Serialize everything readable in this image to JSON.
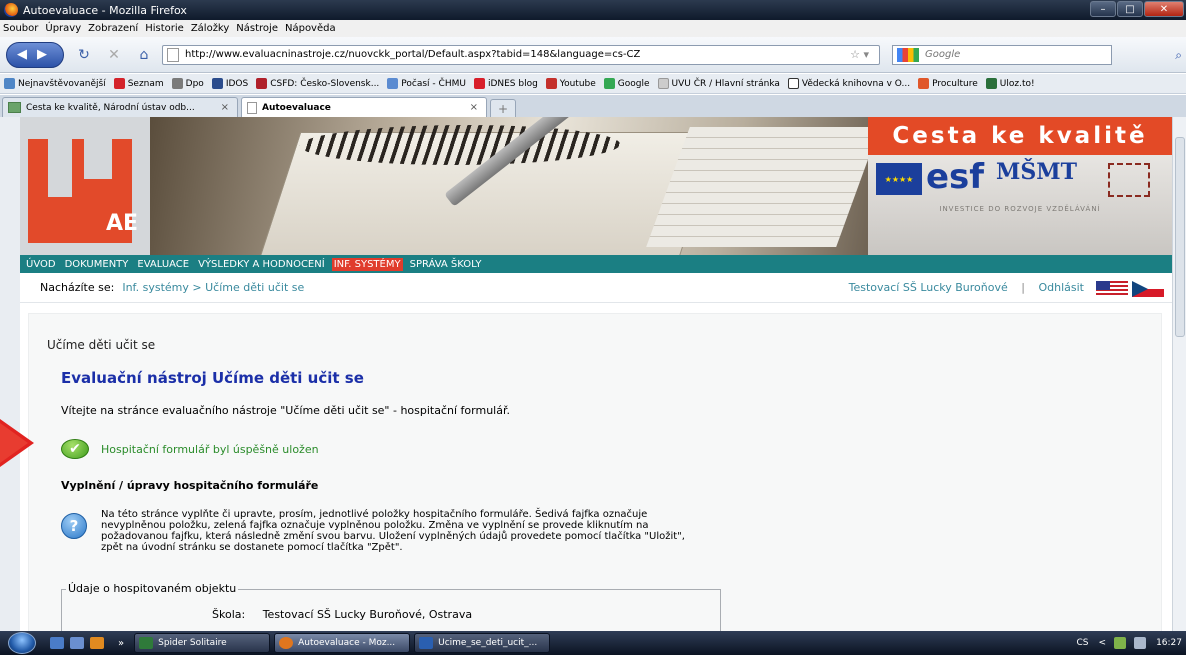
{
  "window": {
    "title": "Autoevaluace - Mozilla Firefox",
    "min": "–",
    "max": "□",
    "close": "✕"
  },
  "menu": [
    "Soubor",
    "Úpravy",
    "Zobrazení",
    "Historie",
    "Záložky",
    "Nástroje",
    "Nápověda"
  ],
  "nav": {
    "url": "http://www.evaluacninastroje.cz/nuovckk_portal/Default.aspx?tabid=148&language=cs-CZ",
    "search_placeholder": "Google"
  },
  "bookmarks": [
    {
      "label": "Nejnavštěvovanější",
      "color": "#4f86c6"
    },
    {
      "label": "Seznam",
      "color": "#d4232b"
    },
    {
      "label": "Dpo",
      "color": "#7a7a7a"
    },
    {
      "label": "IDOS",
      "color": "#2b4c8c"
    },
    {
      "label": "CSFD: Česko-Slovensk...",
      "color": "#b0202a"
    },
    {
      "label": "Počasí - ČHMU",
      "color": "#5b8bd1"
    },
    {
      "label": "iDNES blog",
      "color": "#d81e2a"
    },
    {
      "label": "Youtube",
      "color": "#c4302b"
    },
    {
      "label": "Google",
      "color": "#34a853"
    },
    {
      "label": "UVU ČR / Hlavní stránka",
      "color": "#cccccc"
    },
    {
      "label": "Vědecká knihovna v O...",
      "color": "#ffffff"
    },
    {
      "label": "Proculture",
      "color": "#e0572a"
    },
    {
      "label": "Uloz.to!",
      "color": "#2a6f3a"
    }
  ],
  "tabs": [
    {
      "label": "Cesta ke kvalitě, Národní ústav odb...",
      "close": "×",
      "active": false
    },
    {
      "label": "Autoevaluace",
      "close": "×",
      "active": true
    }
  ],
  "newtab": "+",
  "banner": {
    "ae": "AE",
    "ck_title": "Cesta ke kvalitě",
    "esf": "esf",
    "msmt": "MŠMT",
    "investice": "INVESTICE DO ROZVOJE VZDĚLÁVÁNÍ"
  },
  "mainmenu": [
    {
      "label": "ÚVOD",
      "active": false
    },
    {
      "label": "DOKUMENTY",
      "active": false
    },
    {
      "label": "EVALUACE",
      "active": false
    },
    {
      "label": "VÝSLEDKY A HODNOCENÍ",
      "active": false
    },
    {
      "label": "INF. SYSTÉMY",
      "active": true
    },
    {
      "label": "SPRÁVA ŠKOLY",
      "active": false
    }
  ],
  "breadcrumb": {
    "label": "Nacházíte se:",
    "path": "Inf. systémy > Učíme děti učit se",
    "school": "Testovací SŠ Lucky Buroňové",
    "sep": "|",
    "logout": "Odhlásit"
  },
  "content": {
    "subtitle": "Učíme děti učit se",
    "title": "Evaluační nástroj Učíme děti učit se",
    "welcome": "Vítejte na stránce evaluačního nástroje \"Učíme děti učit se\" - hospitační formulář.",
    "success": "Hospitační formulář byl úspěšně uložen",
    "section": "Vyplnění / úpravy hospitačního formuláře",
    "info_lines": [
      "Na této stránce vyplňte či upravte, prosím, jednotlivé položky hospitačního formuláře. Šedivá fajfka označuje",
      "nevyplněnou položku, zelená fajfka označuje vyplněnou položku. Změna ve vyplnění se provede kliknutím na",
      "požadovanou fajfku, která následně změní svou barvu. Uložení vyplněných údajů provedete pomocí tlačítka \"Uložit\",",
      "zpět na úvodní stránku se dostanete pomocí tlačítka \"Zpět\"."
    ],
    "fieldset_legend": "Údaje o hospitovaném objektu",
    "skola_label": "Škola:",
    "skola_value": "Testovací SŠ Lucky Buroňové, Ostrava"
  },
  "taskbar": {
    "arrows": "»",
    "tasks": [
      {
        "label": "Spider Solitaire",
        "color": "#2f7a3a",
        "active": false
      },
      {
        "label": "Autoevaluace - Moz...",
        "color": "#e0761e",
        "active": true
      },
      {
        "label": "Ucime_se_deti_ucit_...",
        "color": "#2a5fb0",
        "active": false
      }
    ],
    "lang": "CS",
    "chev": "<",
    "time": "16:27"
  }
}
